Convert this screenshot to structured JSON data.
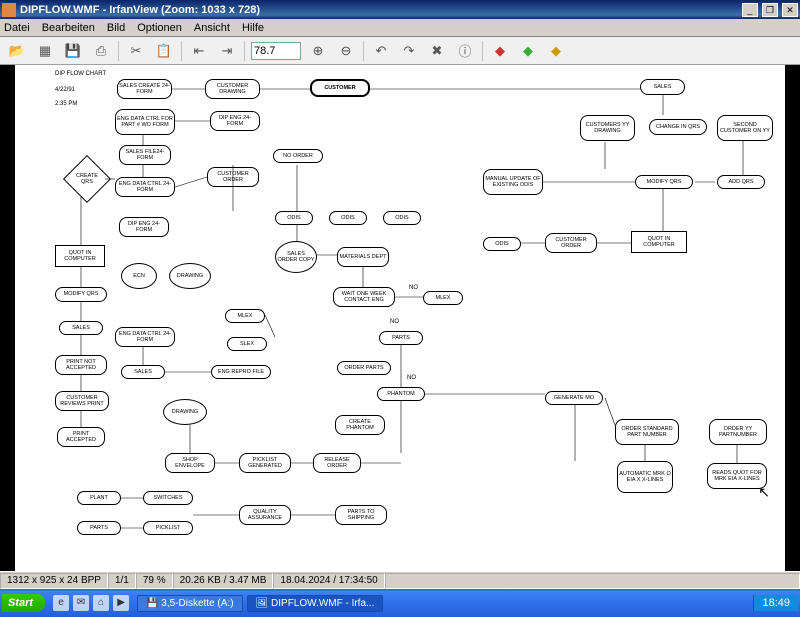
{
  "window": {
    "title": "DIPFLOW.WMF - IrfanView (Zoom: 1033 x 728)",
    "minimize": "_",
    "maximize": "❐",
    "close": "✕"
  },
  "menu": {
    "file": "Datei",
    "edit": "Bearbeiten",
    "image": "Bild",
    "options": "Optionen",
    "view": "Ansicht",
    "help": "Hilfe"
  },
  "toolbar": {
    "zoom_value": "78.7"
  },
  "canvas": {
    "header": "DIP FLOW CHART",
    "date": "4/22/91",
    "time": "2:35 PM"
  },
  "nodes": {
    "sales_create_24form": "SALES CREATE\n24-FORM",
    "customer_drawing": "CUSTOMER\nDRAWING",
    "customer": "CUSTOMER",
    "sales_top": "SALES",
    "eng_data_ctrl_wo": "ENG DATA CTRL\nFOR PART #\nWO FORM",
    "dip_eng_24form": "DIP ENG\n24-FORM",
    "customers_yy_drawing": "CUSTOMERS\nYY\nDRAWING",
    "change_in_qrs": "CHANGE IN QRS",
    "second_customer_yy": "SECOND\nCUSTOMER ON\nYY",
    "sales_file24": "SALES\nFILE24-FORM",
    "no_order": "NO ORDER",
    "create_qrs": "CREATE\nQRS",
    "eng_data_ctrl_24": "ENG DATA CTRL\n24-FORM",
    "customer_order": "CUSTOMER\nORDER",
    "manual_update": "MANUAL\nUPDATE OF\nEXISTING   ODIS",
    "modify_qrs_r": "MODIFY   QRS",
    "add_qrs": "ADD QRS",
    "dip_eng_24b": "DIP ENG\n24-FORM",
    "odis1": "ODIS",
    "odis2": "ODIS",
    "odis3": "ODIS",
    "odis4": "ODIS",
    "customer_order2": "CUSTOMER\nORDER",
    "quot_computer_r": "QUOT\nIN COMPUTER",
    "quot_computer_l": "QUOT\nIN COMPUTER",
    "sales_order_copy": "SALES\nORDER\nCOPY",
    "materials_dept": "MATERIALS\nDEPT",
    "modify_qrs_l": "MODIFY QRS",
    "ecn": "ECN",
    "drawing": "DRAWING",
    "wait_week": "WAIT ONE WEEK\nCONTACT ENG",
    "mlex_r": "MLEX",
    "sales_l": "SALES",
    "mlex_l": "MLEX",
    "eng_data_ctrl_24b": "ENG DATA CTRL\n24-FORM",
    "slex": "SLEX",
    "parts": "PARTS",
    "print_not_acc": "PRINT  NOT\nACCEPTED",
    "order_parts": "ORDER PARTS",
    "sales_m": "SALES",
    "eng_repro": "ENG REPRO FILE",
    "phantom": "PHANTOM",
    "cust_reviews": "CUSTOMER\nREVIEWS PRINT",
    "drawing2": "DRAWING",
    "create_phantom": "CREATE\nPHANTOM",
    "generate_mo": "GENERATE MO",
    "print_acc": "PRINT\nACCEPTED",
    "order_std_part": "ORDER\nSTANDARD PART\nNUMBER",
    "order_yy_part": "ORDER\nYY\nPARTNUMBER",
    "shop_env": "SHOP\nENVELOPE",
    "picklist_gen": "PICKLIST\nGENERATED",
    "release_order": "RELEASE\nORDER",
    "auto_mrk": "AUTOMATIC\nMRK O\nEIA X\nX-LINES",
    "reads_quot": "READS QUOT\nFOR MRK\nEIA     X-LINES",
    "plant": "PLANT",
    "switches": "SWITCHES",
    "parts_b": "PARTS",
    "picklist": "PICKLIST",
    "qa": "QUALITY\nASSURANCE",
    "parts_ship": "PARTS TO\nSHIPPING",
    "no": "NO"
  },
  "status": {
    "dim": "1312 x 925 x 24 BPP",
    "page": "1/1",
    "pct": "79 %",
    "size": "20.26 KB / 3.47 MB",
    "dt": "18.04.2024 / 17:34:50"
  },
  "taskbar": {
    "start": "Start",
    "task1": "3,5-Diskette (A:)",
    "task2": "DIPFLOW.WMF - Irfa...",
    "clock": "18:49"
  }
}
